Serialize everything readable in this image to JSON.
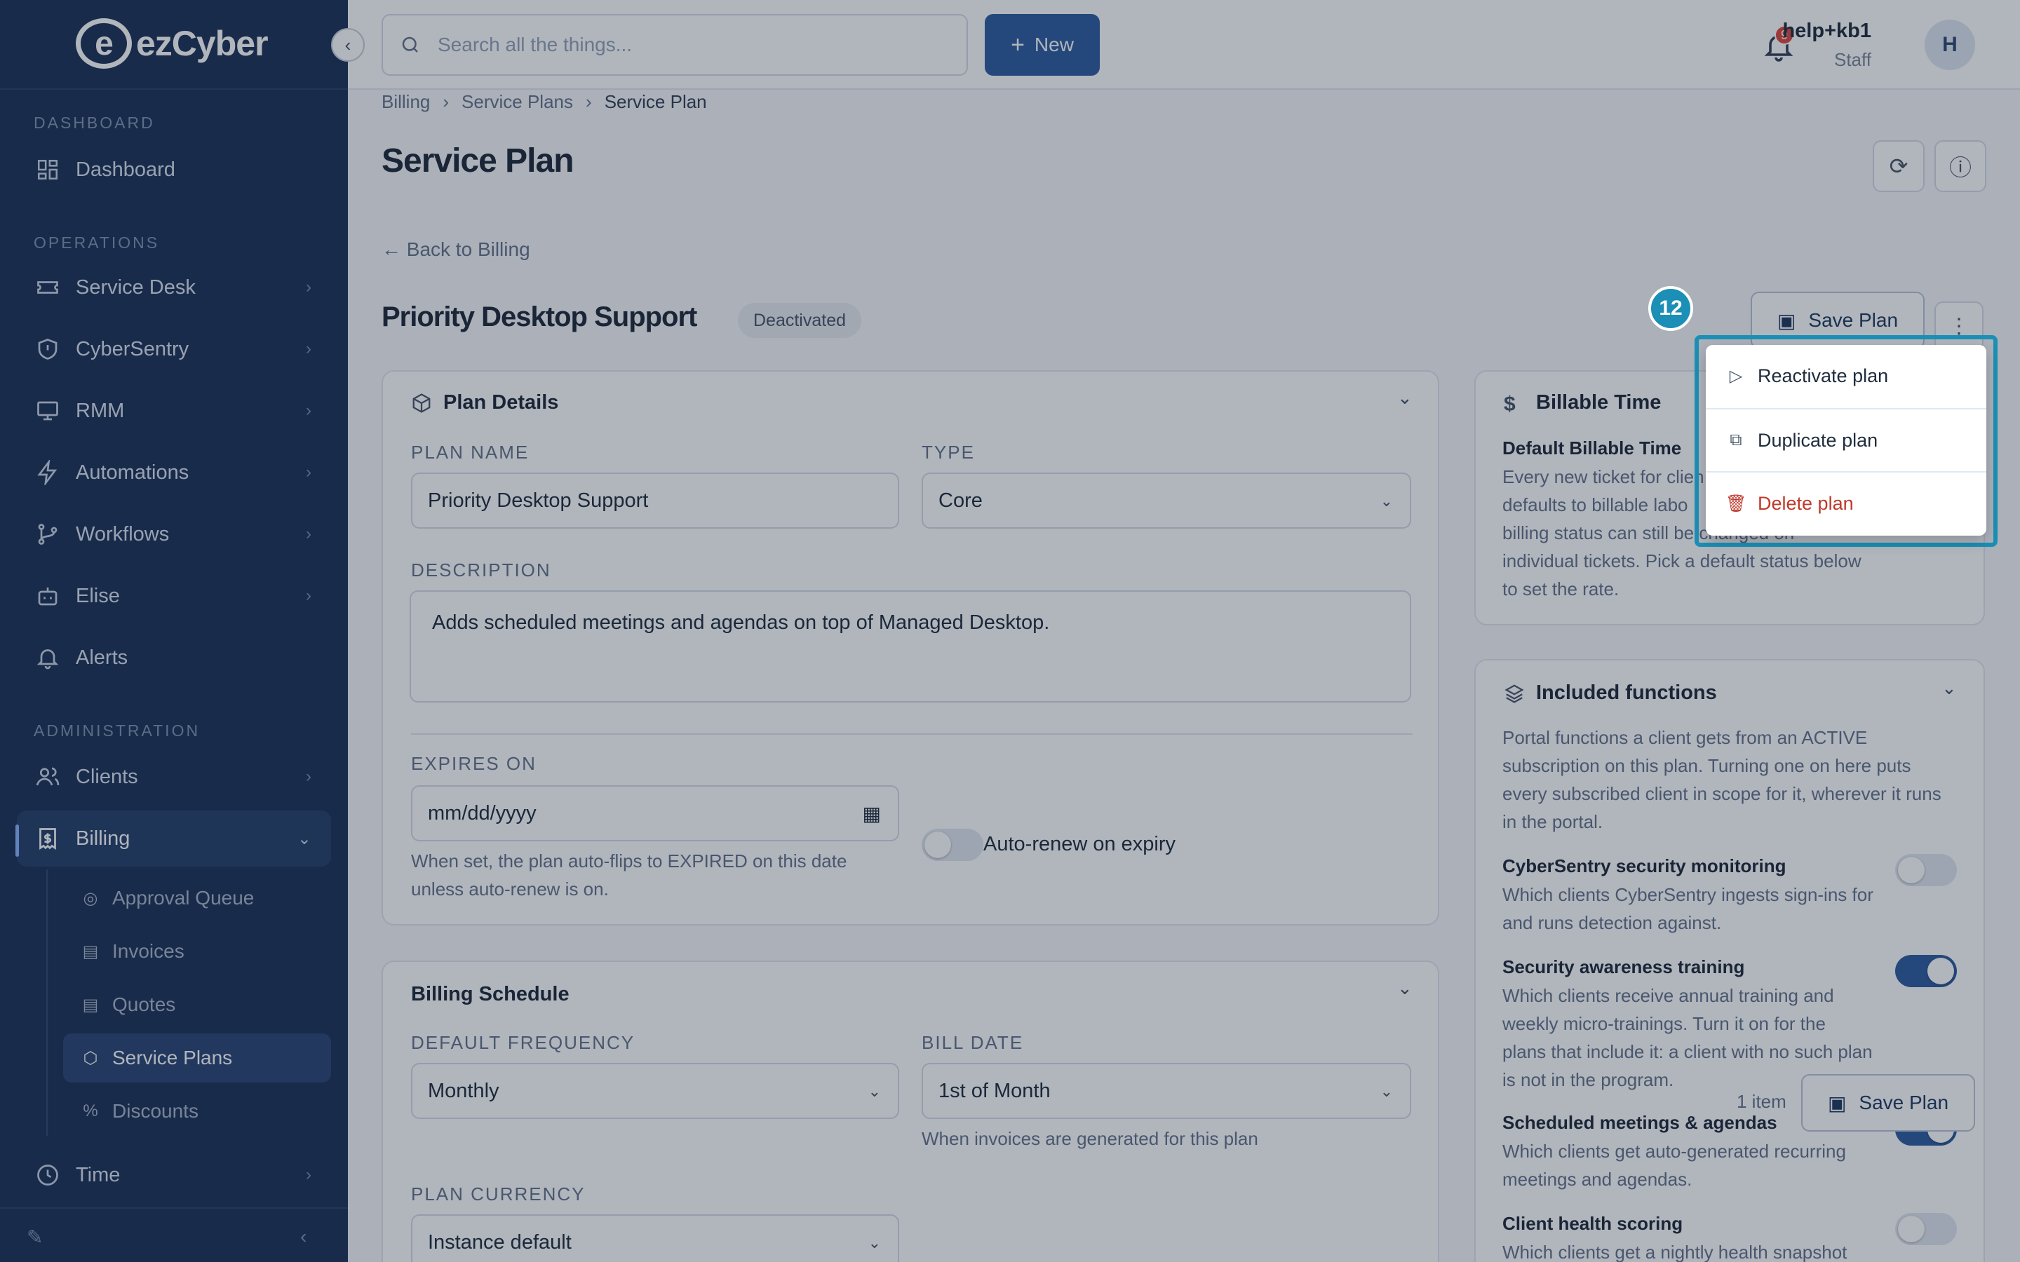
{
  "brand": {
    "name": "ezCyber",
    "mark": "e"
  },
  "sidebar": {
    "sections": {
      "dashboard": "DASHBOARD",
      "operations": "OPERATIONS",
      "administration": "ADMINISTRATION"
    },
    "items": [
      {
        "label": "Dashboard",
        "icon": "grid-icon"
      },
      {
        "label": "Service Desk",
        "icon": "ticket-icon"
      },
      {
        "label": "CyberSentry",
        "icon": "shield-icon"
      },
      {
        "label": "RMM",
        "icon": "monitor-icon"
      },
      {
        "label": "Automations",
        "icon": "bolt-icon"
      },
      {
        "label": "Workflows",
        "icon": "git-branch-icon"
      },
      {
        "label": "Elise",
        "icon": "bot-icon"
      },
      {
        "label": "Alerts",
        "icon": "bell-icon"
      },
      {
        "label": "Clients",
        "icon": "users-icon"
      },
      {
        "label": "Billing",
        "icon": "receipt-icon"
      },
      {
        "label": "Time",
        "icon": "clock-icon"
      }
    ],
    "billing_sub": [
      {
        "label": "Approval Queue"
      },
      {
        "label": "Invoices"
      },
      {
        "label": "Quotes"
      },
      {
        "label": "Service Plans"
      },
      {
        "label": "Discounts"
      }
    ]
  },
  "topbar": {
    "search_placeholder": "Search all the things...",
    "new_label": "New",
    "notifications": "9",
    "user_name": "help+kb1",
    "user_role": "Staff",
    "avatar_initial": "H"
  },
  "breadcrumb": [
    "Billing",
    "Service Plans",
    "Service Plan"
  ],
  "page": {
    "title": "Service Plan",
    "back_label": "Back to Billing",
    "plan_name": "Priority Desktop Support",
    "status": "Deactivated",
    "save_label": "Save Plan"
  },
  "plan_details": {
    "title": "Plan Details",
    "name_label": "PLAN NAME",
    "name_value": "Priority Desktop Support",
    "type_label": "TYPE",
    "type_value": "Core",
    "description_label": "DESCRIPTION",
    "description_value": "Adds scheduled meetings and agendas on top of Managed Desktop.",
    "expires_label": "EXPIRES ON",
    "expires_value": "mm/dd/yyyy",
    "expires_help_1": "When set, the plan auto-flips to EXPIRED on this date",
    "expires_help_2": "unless auto-renew is on.",
    "auto_renew_label": "Auto-renew on expiry"
  },
  "billing_schedule": {
    "title": "Billing Schedule",
    "frequency_label": "DEFAULT FREQUENCY",
    "frequency_value": "Monthly",
    "bill_date_label": "BILL DATE",
    "bill_date_value": "1st of Month",
    "bill_date_help": "When invoices are generated for this plan",
    "currency_label": "PLAN CURRENCY",
    "currency_value": "Instance default"
  },
  "billable_time": {
    "title": "Billable Time",
    "subtitle": "Default Billable Time",
    "lines": [
      "Every new ticket for clien",
      "defaults to billable labo",
      "billing status can still be changed on",
      "individual tickets. Pick a default status below",
      "to set the rate."
    ]
  },
  "included_functions": {
    "title": "Included functions",
    "intro": [
      "Portal functions a client gets from an ACTIVE",
      "subscription on this plan. Turning one on here puts",
      "every subscribed client in scope for it, wherever it runs",
      "in the portal."
    ],
    "items": [
      {
        "title": "CyberSentry security monitoring",
        "lines": [
          "Which clients CyberSentry ingests sign-ins for",
          "and runs detection against."
        ],
        "on": false
      },
      {
        "title": "Security awareness training",
        "lines": [
          "Which clients receive annual training and",
          "weekly micro-trainings. Turn it on for the",
          "plans that include it: a client with no such plan",
          "is not in the program."
        ],
        "on": true
      },
      {
        "title": "Scheduled meetings & agendas",
        "lines": [
          "Which clients get auto-generated recurring",
          "meetings and agendas."
        ],
        "on": true
      },
      {
        "title": "Client health scoring",
        "lines": [
          "Which clients get a nightly health snapshot"
        ],
        "on": false
      }
    ]
  },
  "floating": {
    "count": "1 item",
    "save_label": "Save Plan"
  },
  "menu": {
    "items": [
      {
        "label": "Reactivate plan",
        "icon": "play-icon"
      },
      {
        "label": "Duplicate plan",
        "icon": "copy-icon"
      },
      {
        "label": "Delete plan",
        "icon": "trash-icon"
      }
    ]
  },
  "marker": "12"
}
